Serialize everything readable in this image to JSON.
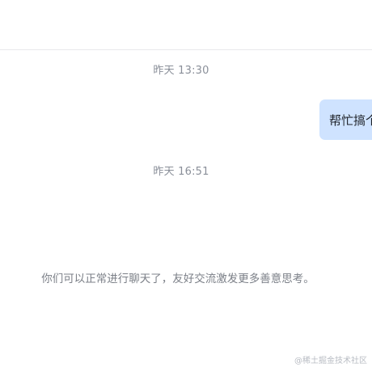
{
  "chat": {
    "timestamps": [
      "昨天 13:30",
      "昨天 16:51"
    ],
    "outgoing_message": "帮忙搞个",
    "system_notice": "你们可以正常进行聊天了，友好交流激发更多善意思考。"
  },
  "watermark": "@稀土掘金技术社区",
  "colors": {
    "bubble_background": "#cfe3ff",
    "timestamp_text": "#8a8f99",
    "divider": "#e8e8ec"
  }
}
